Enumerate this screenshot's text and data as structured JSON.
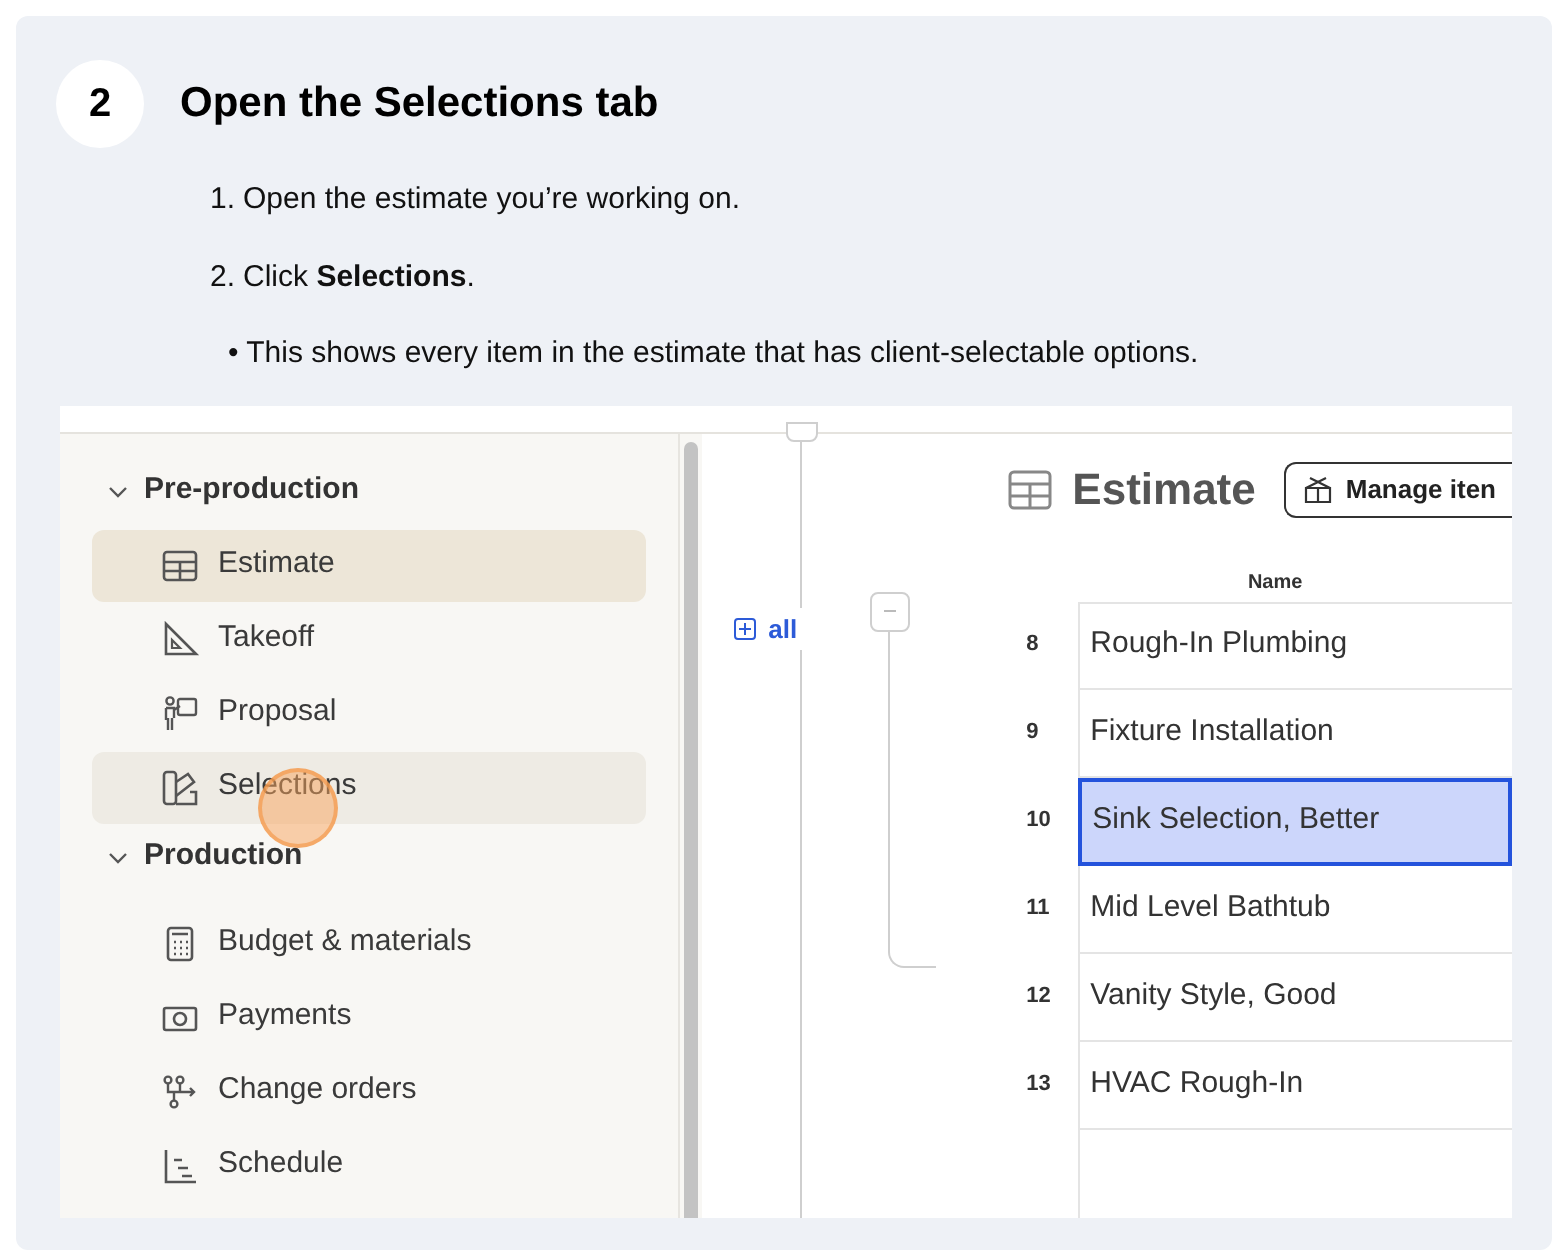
{
  "step": {
    "number": "2",
    "title": "Open the Selections tab"
  },
  "instructions": [
    {
      "marker": "1.",
      "text": "Open the estimate you’re working on."
    },
    {
      "marker": "2.",
      "text": "Click **Selections**."
    }
  ],
  "note": {
    "marker": "•",
    "text": "This shows every item in the estimate that has client-selectable options."
  },
  "sidebar": {
    "sections": [
      {
        "label": "Pre-production",
        "expanded": true,
        "items": [
          {
            "label": "Estimate",
            "selected": true,
            "hovered": false
          },
          {
            "label": "Takeoff",
            "selected": false,
            "hovered": false
          },
          {
            "label": "Proposal",
            "selected": false,
            "hovered": false
          },
          {
            "label": "Selections",
            "selected": false,
            "hovered": true
          }
        ]
      },
      {
        "label": "Production",
        "expanded": true,
        "items": [
          {
            "label": "Budget & materials",
            "selected": false,
            "hovered": false
          },
          {
            "label": "Payments",
            "selected": false,
            "hovered": false
          },
          {
            "label": "Change orders",
            "selected": false,
            "hovered": false
          },
          {
            "label": "Schedule",
            "selected": false,
            "hovered": false
          }
        ]
      }
    ]
  },
  "tree": {
    "expand_all": "all"
  },
  "estimate": {
    "title": "Estimate",
    "manage_button": "Manage iten",
    "column": "Name",
    "rows": [
      {
        "number": "8",
        "name": "Rough-In Plumbing",
        "selected": false
      },
      {
        "number": "9",
        "name": "Fixture Installation",
        "selected": false
      },
      {
        "number": "10",
        "name": "Sink Selection, Better",
        "selected": true
      },
      {
        "number": "11",
        "name": "Mid Level Bathtub",
        "selected": false
      },
      {
        "number": "12",
        "name": "Vanity Style, Good",
        "selected": false
      },
      {
        "number": "13",
        "name": "HVAC Rough-In",
        "selected": false
      }
    ]
  }
}
